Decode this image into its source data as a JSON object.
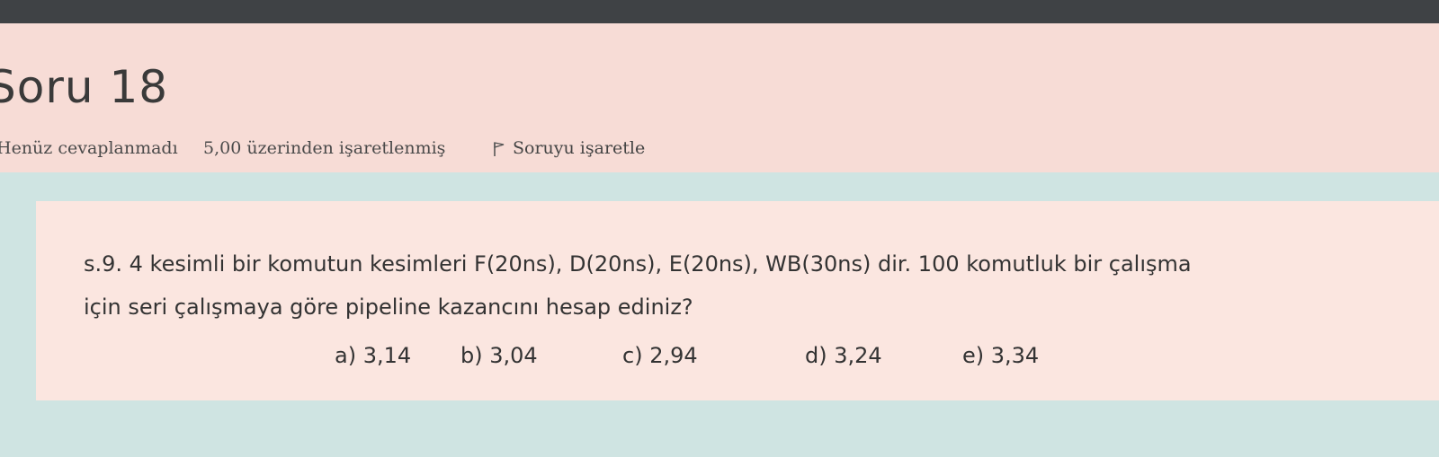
{
  "question": {
    "title": "Soru 18",
    "status": "Henüz cevaplanmadı",
    "grade": "5,00 üzerinden işaretlenmiş",
    "flag_label": "Soruyu işaretle",
    "flag_icon": "flag-icon",
    "text_line1": "s.9. 4 kesimli bir komutun kesimleri F(20ns), D(20ns), E(20ns), WB(30ns) dir. 100 komutluk bir çalışma",
    "text_line2": "için seri çalışmaya göre pipeline kazancını hesap ediniz?",
    "options": [
      "a) 3,14",
      "b) 3,04",
      "c) 2,94",
      "d) 3,24",
      "e) 3,34"
    ]
  },
  "colors": {
    "top_bar": "#3f4245",
    "info_panel": "#f7dcd6",
    "content_area": "#cfe4e2",
    "question_box": "#fbe6e0"
  }
}
